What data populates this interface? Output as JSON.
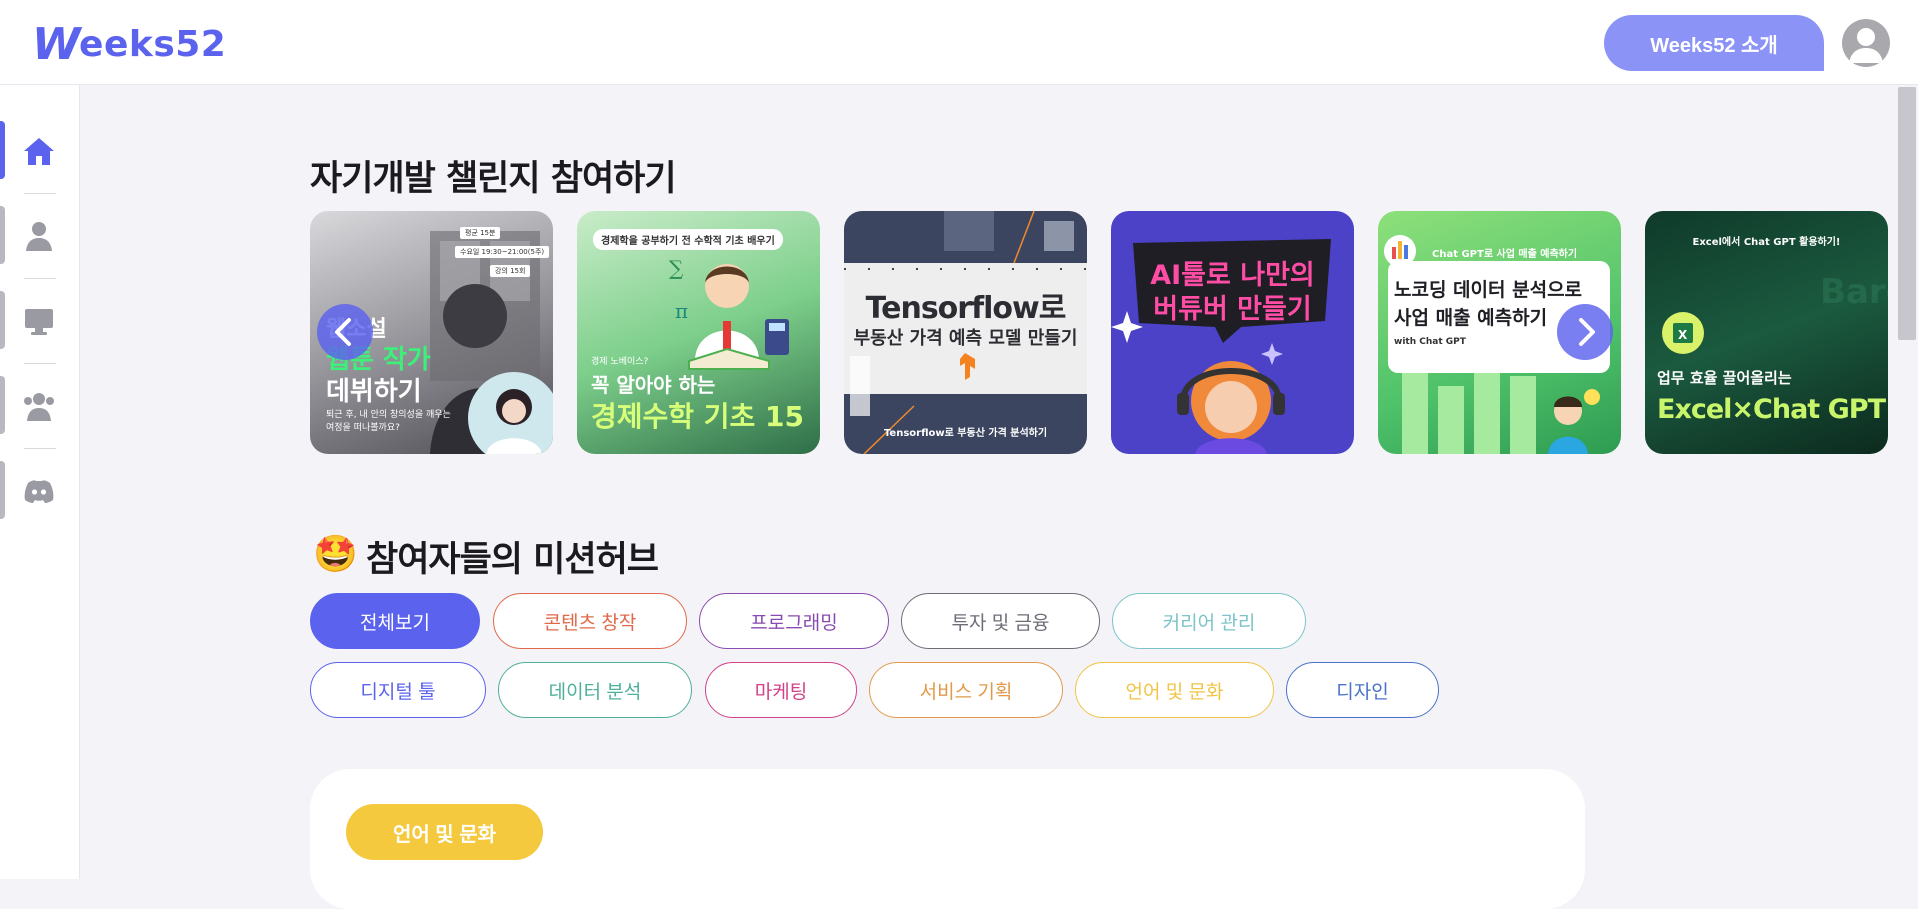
{
  "header": {
    "logo_text": "eeks52",
    "logo_mark": "W",
    "intro_button": "Weeks52 소개"
  },
  "sidebar": {
    "items": [
      {
        "icon": "home-icon",
        "active": true
      },
      {
        "icon": "person-icon",
        "active": false
      },
      {
        "icon": "monitor-icon",
        "active": false
      },
      {
        "icon": "group-icon",
        "active": false
      },
      {
        "icon": "discord-icon",
        "active": false
      }
    ]
  },
  "challenges": {
    "title": "자기개발 챌린지 참여하기",
    "cards": [
      {
        "line1": "웹소설",
        "line2": "웹툰 작가",
        "line3": "데뷔하기",
        "sub": "퇴근 후, 내 안의 창의성을 깨우는 여정을 떠나볼까요?",
        "tag1": "평균 15분",
        "tag2": "수요일 19:30~21:00(5주)",
        "tag3": "강의 15회"
      },
      {
        "top": "경제학을 공부하기 전 수학적 기초 배우기",
        "small": "경제 노베이스?",
        "line1": "꼭 알아야 하는",
        "line2": "경제수학 기초 15"
      },
      {
        "line1": "Tensorflow로",
        "line2": "부동산 가격 예측 모델 만들기",
        "bottom": "Tensorflow로 부동산 가격 분석하기"
      },
      {
        "line1": "AI툴로 나만의",
        "line2": "버튜버 만들기"
      },
      {
        "top": "Chat GPT로 사업 매출 예측하기",
        "line1": "노코딩 데이터 분석으로",
        "line2": "사업 매출 예측하기",
        "small": "with Chat GPT"
      },
      {
        "top": "Excel에서 Chat GPT 활용하기!",
        "line1": "업무 효율 끌어올리는",
        "line2": "Excel×Chat GPT"
      }
    ]
  },
  "missions": {
    "title": "참여자들의 미션허브",
    "title_emoji": "🤩",
    "categories": [
      {
        "label": "전체보기",
        "color": "#5b63ee"
      },
      {
        "label": "콘텐츠 창작",
        "color": "#e0694a"
      },
      {
        "label": "프로그래밍",
        "color": "#8a4bb0"
      },
      {
        "label": "투자 및 금융",
        "color": "#6e6e78"
      },
      {
        "label": "커리어 관리",
        "color": "#7cc4c9"
      },
      {
        "label": "디지털 툴",
        "color": "#5b63ee"
      },
      {
        "label": "데이터 분석",
        "color": "#4fb09a"
      },
      {
        "label": "마케팅",
        "color": "#d2418a"
      },
      {
        "label": "서비스 기획",
        "color": "#e29a4a"
      },
      {
        "label": "언어 및 문화",
        "color": "#f0c445"
      },
      {
        "label": "디자인",
        "color": "#4a72c8"
      }
    ],
    "selected": "전체보기",
    "panel_tag": "언어 및 문화"
  }
}
